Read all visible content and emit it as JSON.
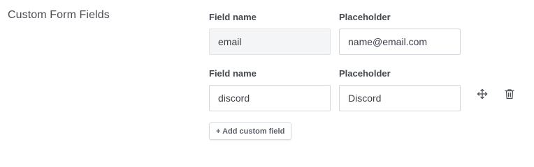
{
  "section": {
    "title": "Custom Form Fields"
  },
  "fields": [
    {
      "name_label": "Field name",
      "placeholder_label": "Placeholder",
      "name_value": "email",
      "placeholder_value": "name@email.com"
    },
    {
      "name_label": "Field name",
      "placeholder_label": "Placeholder",
      "name_value": "discord",
      "placeholder_value": "Discord"
    }
  ],
  "actions": {
    "add_custom_field_label": "+ Add custom field",
    "move_icon": "move-icon",
    "delete_icon": "trash-icon"
  }
}
